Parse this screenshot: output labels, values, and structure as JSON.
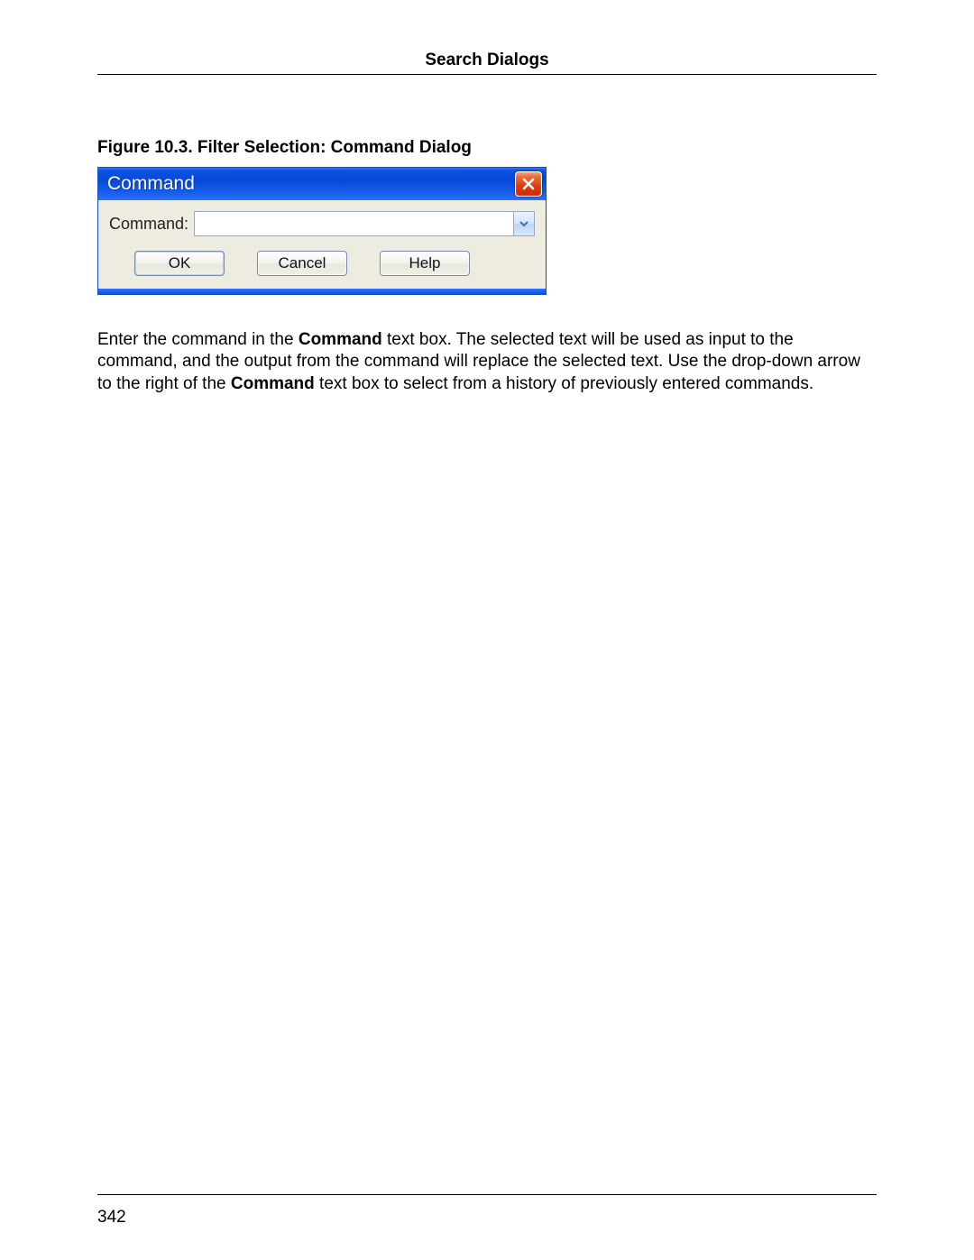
{
  "header": {
    "title": "Search Dialogs"
  },
  "figure": {
    "caption": "Figure 10.3. Filter Selection: Command Dialog"
  },
  "dialog": {
    "title": "Command",
    "form": {
      "command_label": "Command:",
      "command_value": "",
      "command_placeholder": ""
    },
    "buttons": {
      "ok": "OK",
      "cancel": "Cancel",
      "help": "Help"
    }
  },
  "paragraph": {
    "seg1": "Enter the command in the ",
    "bold1": "Command",
    "seg2": " text box. The selected text will be used as input to the command, and the output from the command will replace the selected text. Use the drop-down arrow to the right of the ",
    "bold2": "Command",
    "seg3": " text box to select from a history of previously entered commands."
  },
  "footer": {
    "page_number": "342"
  }
}
